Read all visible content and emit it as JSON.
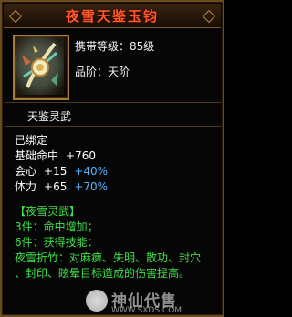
{
  "item": {
    "name": "夜雪天鉴玉钧",
    "carry_level_label": "携带等级：",
    "carry_level_value": "85级",
    "grade_label": "品阶：",
    "grade_value": "天阶",
    "subtitle": "天鉴灵武"
  },
  "stats": {
    "bound": "已绑定",
    "base_hit_label": "基础命中",
    "base_hit_value": "+760",
    "crit_label": "会心",
    "crit_flat": "+15",
    "crit_pct": "+40%",
    "stam_label": "体力",
    "stam_flat": "+65",
    "stam_pct": "+70%"
  },
  "set": {
    "header": "【夜雪灵武】",
    "line1": "3件：命中增加；",
    "line2": "6件：获得技能：",
    "line3": "夜雪折竹：对麻痹、失明、散功、封穴",
    "line4": "、封印、眩晕目标造成的伤害提高。"
  },
  "watermark": {
    "text": "神仙代售",
    "url": "WWW.SXDS.COM"
  },
  "colors": {
    "title": "#ff5a2a",
    "stat_white": "#ffffff",
    "stat_blue": "#58b4ff",
    "set_green": "#3fe04a",
    "border": "#6b4a22"
  },
  "icons": {
    "item": "jade-weapon-icon"
  }
}
